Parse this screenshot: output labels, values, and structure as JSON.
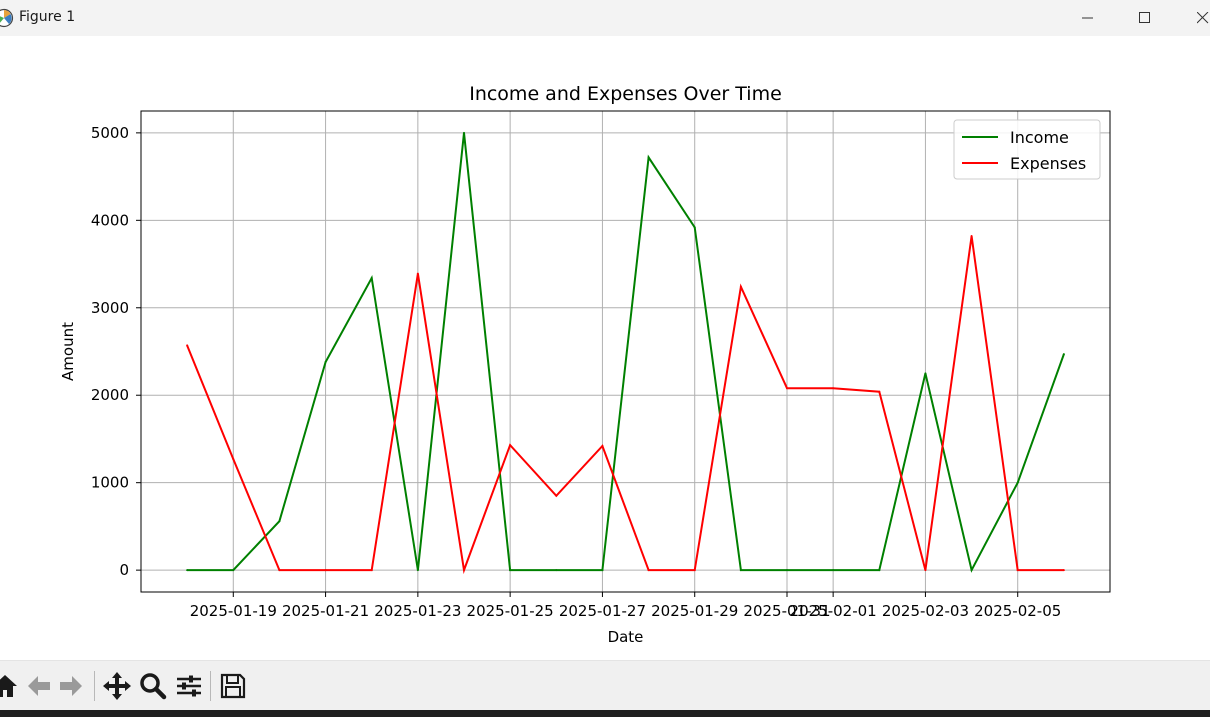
{
  "window": {
    "title": "Figure 1",
    "icon": "matplotlib-icon",
    "controls": [
      "minimize-icon",
      "maximize-icon",
      "close-icon"
    ]
  },
  "toolbar": {
    "tools": [
      "home-icon",
      "back-arrow-icon",
      "forward-arrow-icon",
      "pan-move-icon",
      "zoom-magnifier-icon",
      "configure-subplots-icon",
      "save-disk-icon"
    ]
  },
  "chart_data": {
    "type": "line",
    "title": "Income and Expenses Over Time",
    "xlabel": "Date",
    "ylabel": "Amount",
    "x": [
      "2025-01-18",
      "2025-01-19",
      "2025-01-20",
      "2025-01-21",
      "2025-01-22",
      "2025-01-23",
      "2025-01-24",
      "2025-01-25",
      "2025-01-26",
      "2025-01-27",
      "2025-01-28",
      "2025-01-29",
      "2025-01-30",
      "2025-01-31",
      "2025-02-01",
      "2025-02-02",
      "2025-02-03",
      "2025-02-04",
      "2025-02-05",
      "2025-02-06"
    ],
    "series": [
      {
        "name": "Income",
        "color": "#008000",
        "values": [
          0,
          0,
          560,
          2380,
          3340,
          0,
          5000,
          0,
          0,
          0,
          4720,
          3920,
          0,
          0,
          0,
          0,
          2250,
          0,
          1000,
          2470
        ]
      },
      {
        "name": "Expenses",
        "color": "#ff0000",
        "values": [
          2570,
          1270,
          0,
          0,
          0,
          3390,
          0,
          1430,
          850,
          1420,
          0,
          0,
          3240,
          2080,
          2080,
          2040,
          0,
          3820,
          0,
          0
        ]
      }
    ],
    "xticks": [
      "2025-01-19",
      "2025-01-21",
      "2025-01-23",
      "2025-01-25",
      "2025-01-27",
      "2025-01-29",
      "2025-01-31",
      "2025-02-01",
      "2025-02-03",
      "2025-02-05"
    ],
    "yticks": [
      0,
      1000,
      2000,
      3000,
      4000,
      5000
    ],
    "xlim": [
      "2025-01-17",
      "2025-02-07"
    ],
    "ylim": [
      -250,
      5250
    ],
    "grid": true,
    "legend": "upper right"
  }
}
